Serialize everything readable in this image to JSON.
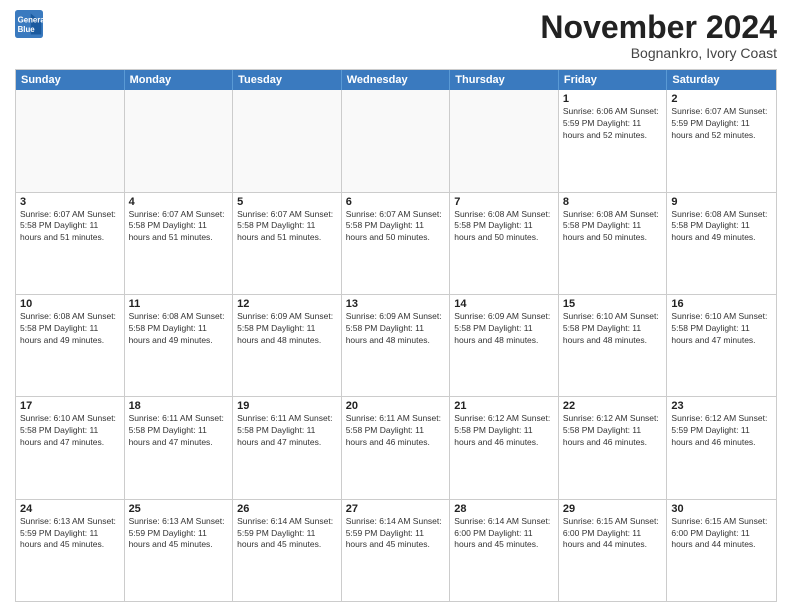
{
  "logo": {
    "line1": "General",
    "line2": "Blue"
  },
  "title": "November 2024",
  "location": "Bognankro, Ivory Coast",
  "weekdays": [
    "Sunday",
    "Monday",
    "Tuesday",
    "Wednesday",
    "Thursday",
    "Friday",
    "Saturday"
  ],
  "rows": [
    [
      {
        "day": "",
        "info": ""
      },
      {
        "day": "",
        "info": ""
      },
      {
        "day": "",
        "info": ""
      },
      {
        "day": "",
        "info": ""
      },
      {
        "day": "",
        "info": ""
      },
      {
        "day": "1",
        "info": "Sunrise: 6:06 AM\nSunset: 5:59 PM\nDaylight: 11 hours\nand 52 minutes."
      },
      {
        "day": "2",
        "info": "Sunrise: 6:07 AM\nSunset: 5:59 PM\nDaylight: 11 hours\nand 52 minutes."
      }
    ],
    [
      {
        "day": "3",
        "info": "Sunrise: 6:07 AM\nSunset: 5:58 PM\nDaylight: 11 hours\nand 51 minutes."
      },
      {
        "day": "4",
        "info": "Sunrise: 6:07 AM\nSunset: 5:58 PM\nDaylight: 11 hours\nand 51 minutes."
      },
      {
        "day": "5",
        "info": "Sunrise: 6:07 AM\nSunset: 5:58 PM\nDaylight: 11 hours\nand 51 minutes."
      },
      {
        "day": "6",
        "info": "Sunrise: 6:07 AM\nSunset: 5:58 PM\nDaylight: 11 hours\nand 50 minutes."
      },
      {
        "day": "7",
        "info": "Sunrise: 6:08 AM\nSunset: 5:58 PM\nDaylight: 11 hours\nand 50 minutes."
      },
      {
        "day": "8",
        "info": "Sunrise: 6:08 AM\nSunset: 5:58 PM\nDaylight: 11 hours\nand 50 minutes."
      },
      {
        "day": "9",
        "info": "Sunrise: 6:08 AM\nSunset: 5:58 PM\nDaylight: 11 hours\nand 49 minutes."
      }
    ],
    [
      {
        "day": "10",
        "info": "Sunrise: 6:08 AM\nSunset: 5:58 PM\nDaylight: 11 hours\nand 49 minutes."
      },
      {
        "day": "11",
        "info": "Sunrise: 6:08 AM\nSunset: 5:58 PM\nDaylight: 11 hours\nand 49 minutes."
      },
      {
        "day": "12",
        "info": "Sunrise: 6:09 AM\nSunset: 5:58 PM\nDaylight: 11 hours\nand 48 minutes."
      },
      {
        "day": "13",
        "info": "Sunrise: 6:09 AM\nSunset: 5:58 PM\nDaylight: 11 hours\nand 48 minutes."
      },
      {
        "day": "14",
        "info": "Sunrise: 6:09 AM\nSunset: 5:58 PM\nDaylight: 11 hours\nand 48 minutes."
      },
      {
        "day": "15",
        "info": "Sunrise: 6:10 AM\nSunset: 5:58 PM\nDaylight: 11 hours\nand 48 minutes."
      },
      {
        "day": "16",
        "info": "Sunrise: 6:10 AM\nSunset: 5:58 PM\nDaylight: 11 hours\nand 47 minutes."
      }
    ],
    [
      {
        "day": "17",
        "info": "Sunrise: 6:10 AM\nSunset: 5:58 PM\nDaylight: 11 hours\nand 47 minutes."
      },
      {
        "day": "18",
        "info": "Sunrise: 6:11 AM\nSunset: 5:58 PM\nDaylight: 11 hours\nand 47 minutes."
      },
      {
        "day": "19",
        "info": "Sunrise: 6:11 AM\nSunset: 5:58 PM\nDaylight: 11 hours\nand 47 minutes."
      },
      {
        "day": "20",
        "info": "Sunrise: 6:11 AM\nSunset: 5:58 PM\nDaylight: 11 hours\nand 46 minutes."
      },
      {
        "day": "21",
        "info": "Sunrise: 6:12 AM\nSunset: 5:58 PM\nDaylight: 11 hours\nand 46 minutes."
      },
      {
        "day": "22",
        "info": "Sunrise: 6:12 AM\nSunset: 5:58 PM\nDaylight: 11 hours\nand 46 minutes."
      },
      {
        "day": "23",
        "info": "Sunrise: 6:12 AM\nSunset: 5:59 PM\nDaylight: 11 hours\nand 46 minutes."
      }
    ],
    [
      {
        "day": "24",
        "info": "Sunrise: 6:13 AM\nSunset: 5:59 PM\nDaylight: 11 hours\nand 45 minutes."
      },
      {
        "day": "25",
        "info": "Sunrise: 6:13 AM\nSunset: 5:59 PM\nDaylight: 11 hours\nand 45 minutes."
      },
      {
        "day": "26",
        "info": "Sunrise: 6:14 AM\nSunset: 5:59 PM\nDaylight: 11 hours\nand 45 minutes."
      },
      {
        "day": "27",
        "info": "Sunrise: 6:14 AM\nSunset: 5:59 PM\nDaylight: 11 hours\nand 45 minutes."
      },
      {
        "day": "28",
        "info": "Sunrise: 6:14 AM\nSunset: 6:00 PM\nDaylight: 11 hours\nand 45 minutes."
      },
      {
        "day": "29",
        "info": "Sunrise: 6:15 AM\nSunset: 6:00 PM\nDaylight: 11 hours\nand 44 minutes."
      },
      {
        "day": "30",
        "info": "Sunrise: 6:15 AM\nSunset: 6:00 PM\nDaylight: 11 hours\nand 44 minutes."
      }
    ]
  ]
}
